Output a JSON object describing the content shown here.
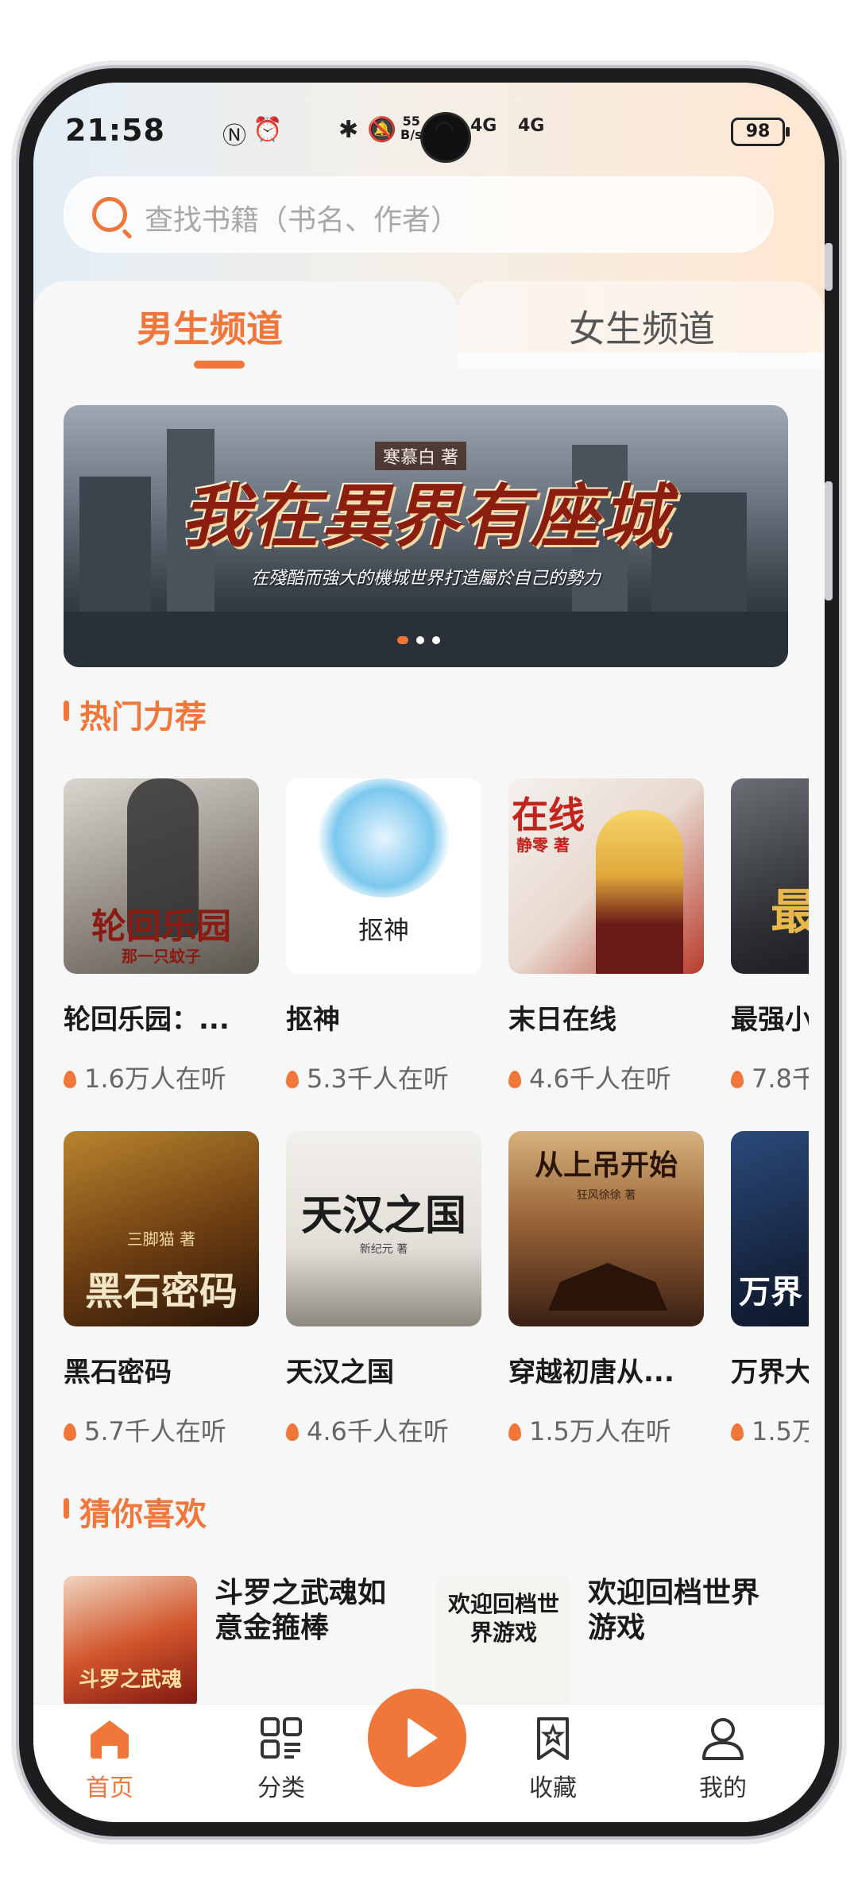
{
  "status_bar": {
    "time": "21:58",
    "net_speed_value": "55",
    "net_speed_unit": "B/s",
    "network_1": "4G",
    "network_2": "4G",
    "battery": "98"
  },
  "search": {
    "placeholder": "查找书籍（书名、作者）"
  },
  "tabs": [
    {
      "label": "男生频道",
      "active": true
    },
    {
      "label": "女生频道",
      "active": false
    }
  ],
  "banner": {
    "author": "寒慕白 著",
    "title": "我在異界有座城",
    "subtitle": "在殘酷而強大的機城世界打造屬於自己的勢力",
    "slides": 3,
    "active_slide": 0
  },
  "hot": {
    "title": "热门力荐",
    "books": [
      {
        "title": "轮回乐园：...",
        "listeners": "1.6万人在听",
        "cover_text": "轮回乐园",
        "cover_sub": "那一只蚊子"
      },
      {
        "title": "抠神",
        "listeners": "5.3千人在听",
        "cover_text": "抠神"
      },
      {
        "title": "末日在线",
        "listeners": "4.6千人在听",
        "cover_text": "在线",
        "cover_sub": "静零 著"
      },
      {
        "title": "最强小",
        "listeners": "7.8千",
        "cover_text": "最"
      },
      {
        "title": "黑石密码",
        "listeners": "5.7千人在听",
        "cover_text": "黑石密码",
        "cover_sub": "三脚猫 著"
      },
      {
        "title": "天汉之国",
        "listeners": "4.6千人在听",
        "cover_text": "天汉之国",
        "cover_sub": "新纪元 著"
      },
      {
        "title": "穿越初唐从...",
        "listeners": "1.5万人在听",
        "cover_text": "从上吊开始",
        "cover_sub": "狂风徐徐 著"
      },
      {
        "title": "万界大",
        "listeners": "1.5万",
        "cover_text": "万界"
      }
    ]
  },
  "guess": {
    "title": "猜你喜欢",
    "books": [
      {
        "title": "斗罗之武魂如意金箍棒",
        "cover_text": "斗罗之武魂"
      },
      {
        "title": "欢迎回档世界游戏",
        "cover_text": "欢迎回档世界游戏"
      }
    ]
  },
  "nav": [
    {
      "label": "首页",
      "icon": "home-icon",
      "active": true
    },
    {
      "label": "分类",
      "icon": "category-icon",
      "active": false
    },
    {
      "label": "",
      "icon": "play-icon",
      "active": false
    },
    {
      "label": "收藏",
      "icon": "bookmark-star-icon",
      "active": false
    },
    {
      "label": "我的",
      "icon": "user-icon",
      "active": false
    }
  ],
  "colors": {
    "accent": "#f0763a",
    "text": "#1a1a1a",
    "muted": "#666666"
  }
}
